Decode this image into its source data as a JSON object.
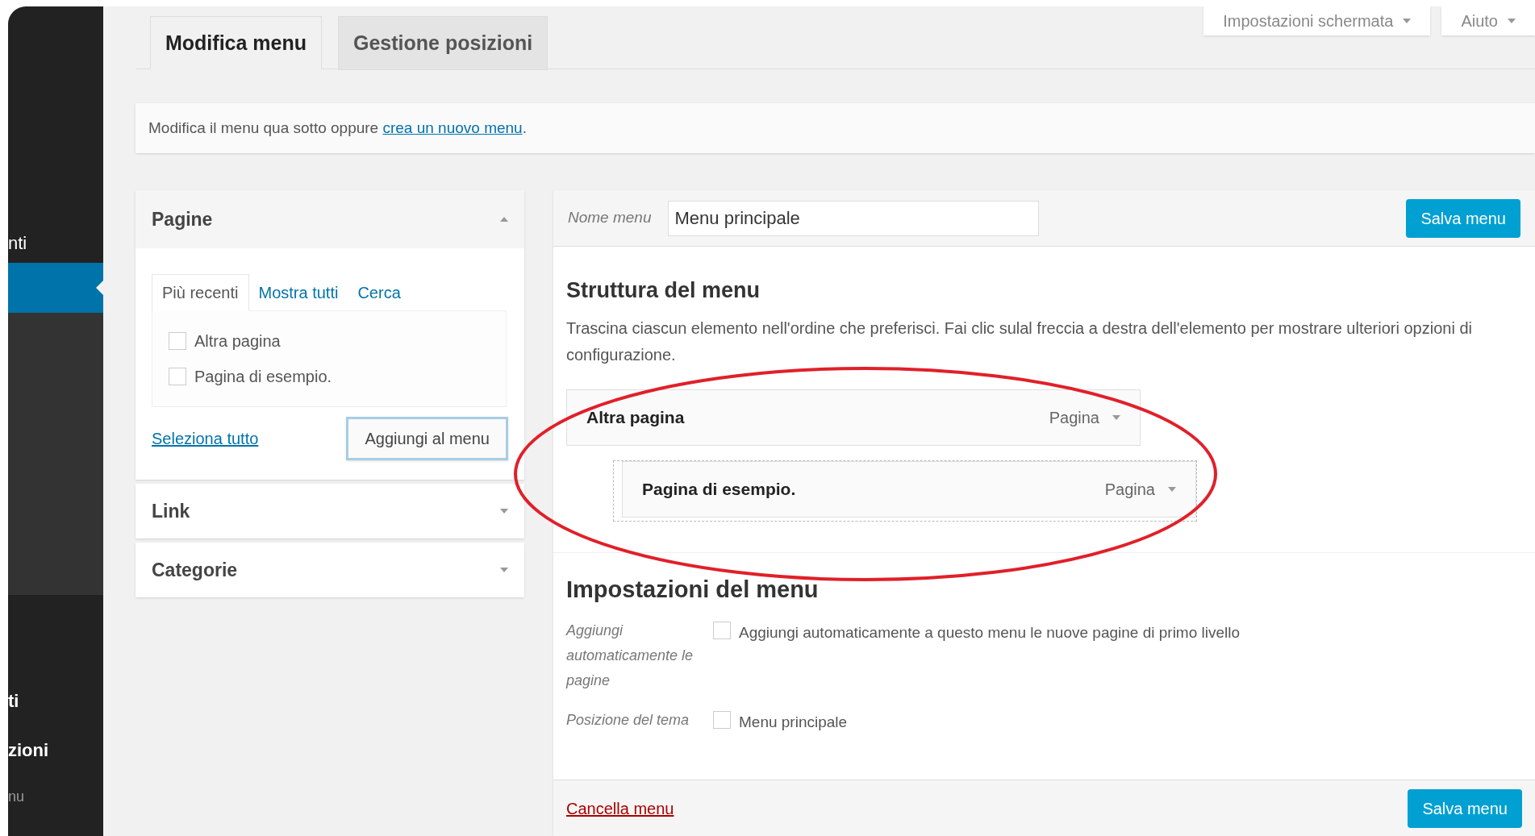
{
  "sidebar": {
    "items": [
      {
        "label": "nti",
        "selected": false
      },
      {
        "selected": true
      }
    ],
    "submenu_items": [
      "ti",
      "zioni",
      "nu"
    ]
  },
  "tabs": [
    {
      "label": "Modifica menu",
      "selected": true
    },
    {
      "label": "Gestione posizioni",
      "selected": false
    }
  ],
  "screen_options": [
    "Impostazioni schermata",
    "Aiuto"
  ],
  "notice": {
    "text": "Modifica il menu qua sotto oppure ",
    "link": "crea un nuovo menu",
    "after": "."
  },
  "left_panels": [
    {
      "title": "Pagine",
      "expanded": true,
      "tabs": [
        {
          "label": "Più recenti",
          "selected": true
        },
        {
          "label": "Mostra tutti",
          "selected": false
        },
        {
          "label": "Cerca",
          "selected": false
        }
      ],
      "items": [
        {
          "label": "Altra pagina",
          "checked": false
        },
        {
          "label": "Pagina di esempio.",
          "checked": false
        }
      ],
      "select_all": "Seleziona tutto",
      "add_button": "Aggiungi al menu"
    },
    {
      "title": "Link",
      "expanded": false
    },
    {
      "title": "Categorie",
      "expanded": false
    }
  ],
  "menu_name": {
    "label": "Nome menu",
    "value": "Menu principale"
  },
  "save_button": "Salva menu",
  "structure": {
    "title": "Struttura del menu",
    "description": "Trascina ciascun elemento nell'ordine che preferisci. Fai clic sulal freccia a destra dell'elemento per mostrare ulteriori opzioni di configurazione.",
    "items": [
      {
        "label": "Altra pagina",
        "type": "Pagina",
        "children": [
          {
            "label": "Pagina di esempio.",
            "type": "Pagina"
          }
        ]
      }
    ]
  },
  "settings": {
    "title": "Impostazioni del menu",
    "rows": [
      {
        "label": "Aggiungi automaticamente le pagine",
        "option": "Aggiungi automaticamente a questo menu le nuove pagine di primo livello",
        "checked": false
      },
      {
        "label": "Posizione del tema",
        "option": "Menu principale",
        "checked": false
      }
    ]
  },
  "delete_link": "Cancella menu",
  "footer_save_button": "Salva menu"
}
